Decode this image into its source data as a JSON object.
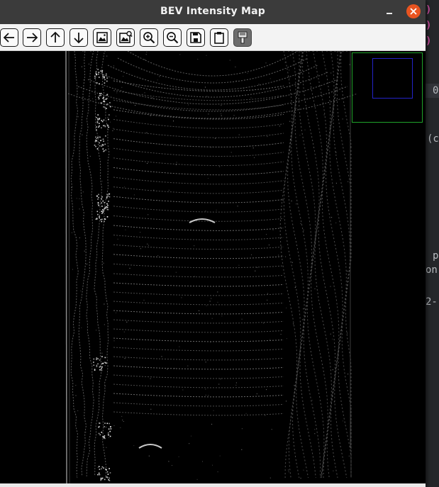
{
  "window": {
    "title": "BEV Intensity Map"
  },
  "toolbar": {
    "tools": [
      {
        "icon": "arrow-left-icon"
      },
      {
        "icon": "arrow-right-icon"
      },
      {
        "icon": "arrow-up-icon"
      },
      {
        "icon": "arrow-down-icon"
      },
      {
        "icon": "image-icon"
      },
      {
        "icon": "image-zoom-icon"
      },
      {
        "icon": "zoom-in-icon"
      },
      {
        "icon": "zoom-out-icon"
      },
      {
        "icon": "save-icon"
      },
      {
        "icon": "clipboard-icon"
      },
      {
        "icon": "paint-brush-icon",
        "active": true
      }
    ]
  },
  "background_editor": {
    "fragments": [
      ")",
      ")",
      ")",
      "0",
      "(c",
      "p",
      "on-",
      "2-"
    ]
  },
  "colors": {
    "titlebar": "#3b3b3b",
    "close": "#e95420",
    "toolbar": "#f3f3f3",
    "minimap_border": "#1fa32a",
    "minimap_view": "#2323c8",
    "code_paren": "#d24fa3"
  }
}
